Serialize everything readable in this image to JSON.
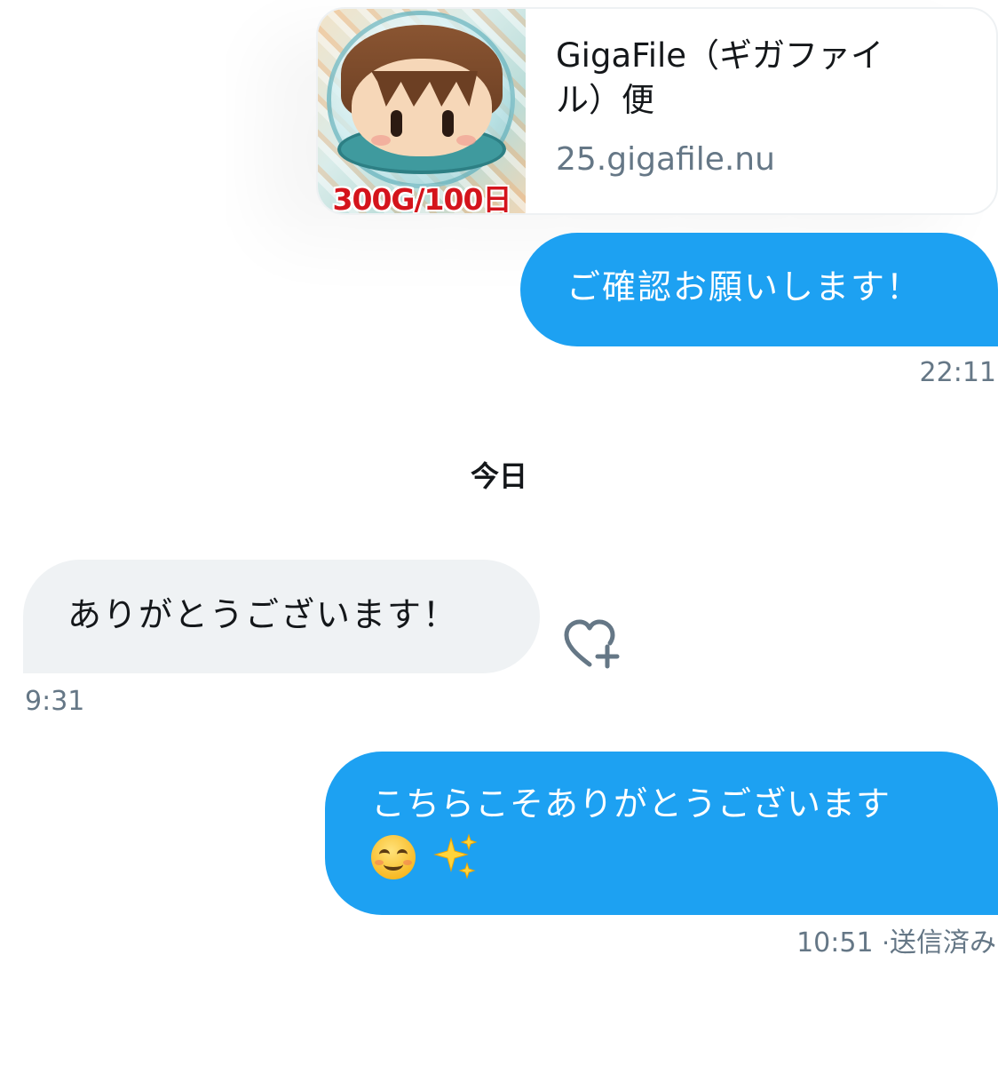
{
  "link_card": {
    "thumbnail_badge": "300G/100日",
    "title": "GigaFile（ギガファイル）便",
    "domain": "25.gigafile.nu"
  },
  "messages": [
    {
      "direction": "outgoing",
      "text": "ご確認お願いします！",
      "time": "22:11"
    },
    {
      "direction": "incoming",
      "text": "ありがとうございます！",
      "time": "9:31"
    },
    {
      "direction": "outgoing",
      "text": "こちらこそありがとうございます",
      "emoji": [
        "smiling-face-icon",
        "sparkles-icon"
      ],
      "time": "10:51",
      "status": "送信済み"
    }
  ],
  "date_separator": "今日",
  "status_separator": "·",
  "colors": {
    "outgoing_bubble": "#1da1f2",
    "incoming_bubble": "#eff2f4",
    "timestamp": "#657786",
    "badge_red": "#d4141c"
  },
  "icons": {
    "reaction": "heart-plus-icon"
  }
}
